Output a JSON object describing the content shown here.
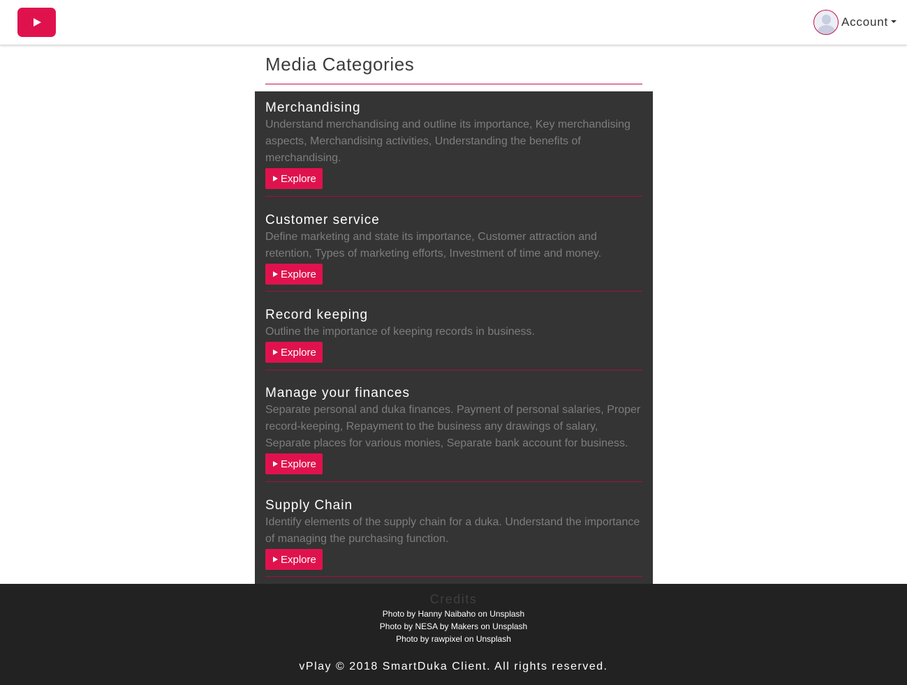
{
  "navbar": {
    "logo_icon": "play-icon",
    "account_label": "Account",
    "brand_color": "#e0124e"
  },
  "main": {
    "page_title": "Media Categories",
    "categories": [
      {
        "title": "Merchandising",
        "description": "Understand merchandising and outline its importance, Key merchandising aspects, Merchandising activities, Understanding the benefits of merchandising.",
        "button_label": "Explore"
      },
      {
        "title": "Customer service",
        "description": "Define marketing and state its importance, Customer attraction and retention, Types of marketing efforts, Investment of time and money.",
        "button_label": "Explore"
      },
      {
        "title": "Record keeping",
        "description": "Outline the importance of keeping records in business.",
        "button_label": "Explore"
      },
      {
        "title": "Manage your finances",
        "description": "Separate personal and duka finances. Payment of personal salaries, Proper record-keeping, Repayment to the business any drawings of salary, Separate places for various monies, Separate bank account for business.",
        "button_label": "Explore"
      },
      {
        "title": "Supply Chain",
        "description": "Identify elements of the supply chain for a duka. Understand the importance of managing the purchasing function.",
        "button_label": "Explore"
      }
    ]
  },
  "footer": {
    "credits_title": "Credits",
    "credits": [
      "Photo by Hanny Naibaho on Unsplash",
      "Photo by NESA by Makers on Unsplash",
      "Photo by rawpixel on Unsplash"
    ],
    "copyright": "vPlay © 2018 SmartDuka Client. All rights reserved."
  }
}
